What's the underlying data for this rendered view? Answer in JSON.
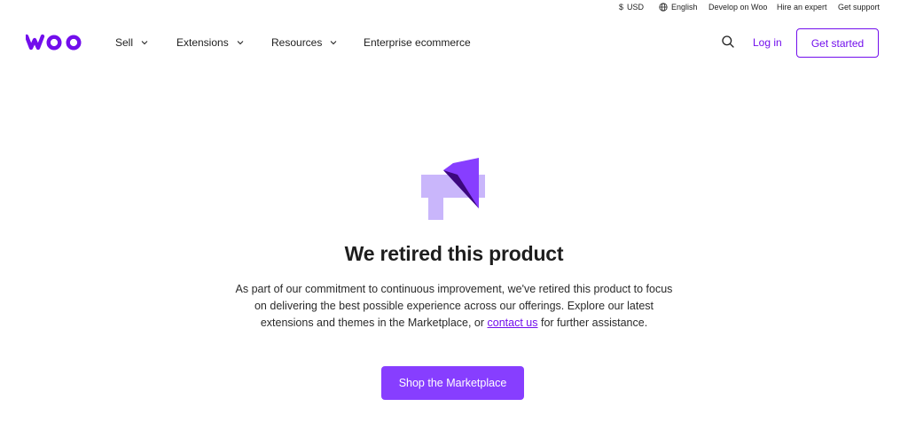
{
  "utility_bar": {
    "currency": {
      "icon": "dollar-icon",
      "glyph": "$",
      "label": "USD"
    },
    "language": {
      "icon": "globe-icon",
      "label": "English"
    },
    "develop": "Develop on Woo",
    "hire": "Hire an expert",
    "support": "Get support"
  },
  "header": {
    "logo_text": "woo",
    "nav": {
      "sell": "Sell",
      "extensions": "Extensions",
      "resources": "Resources",
      "enterprise": "Enterprise ecommerce"
    },
    "login": "Log in",
    "get_started": "Get started"
  },
  "notice": {
    "icon": "megaphone-icon",
    "title": "We retired this product",
    "desc_before": "As part of our commitment to continuous improvement, we've retired this product to focus on delivering the best possible experience across our offerings. Explore our latest extensions and themes in the Marketplace, or ",
    "desc_link": "contact us",
    "desc_after": " for further assistance.",
    "cta": "Shop the Marketplace"
  },
  "colors": {
    "brand": "#720eec",
    "button": "#873eff",
    "icon_light": "#c9b6fb",
    "icon_mid": "#873eff",
    "icon_dark": "#3c087e"
  }
}
